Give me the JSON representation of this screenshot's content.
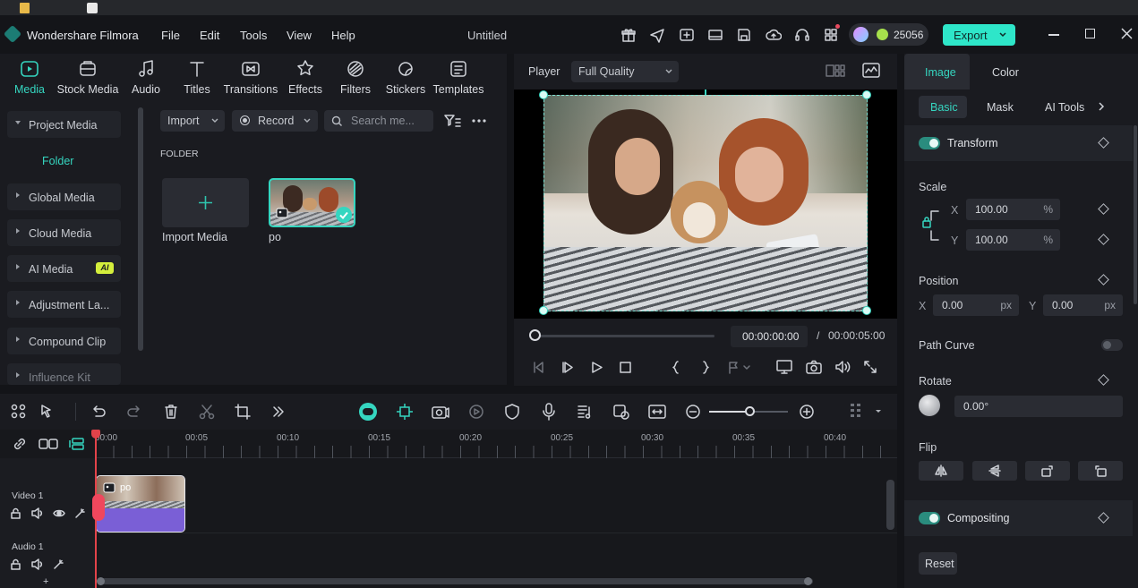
{
  "app": {
    "title": "Wondershare Filmora",
    "project_title": "Untitled",
    "credits": "25056",
    "export_label": "Export"
  },
  "menu": [
    "File",
    "Edit",
    "Tools",
    "View",
    "Help"
  ],
  "media_tabs": [
    "Media",
    "Stock Media",
    "Audio",
    "Titles",
    "Transitions",
    "Effects",
    "Filters",
    "Stickers",
    "Templates"
  ],
  "sidebar": {
    "project_media": "Project Media",
    "folder": "Folder",
    "items": [
      "Global Media",
      "Cloud Media",
      "AI Media",
      "Adjustment La...",
      "Compound Clip",
      "Influence Kit"
    ],
    "ai_badge": "AI"
  },
  "media": {
    "import_label": "Import",
    "record_label": "Record",
    "search_placeholder": "Search me...",
    "folder_heading": "FOLDER",
    "import_media_label": "Import Media",
    "clip_name": "po"
  },
  "player": {
    "label": "Player",
    "quality": "Full Quality",
    "current_time": "00:00:00:00",
    "separator": "/",
    "total_time": "00:00:05:00",
    "progress": 0
  },
  "props": {
    "tabs": [
      "Image",
      "Color"
    ],
    "subtabs": [
      "Basic",
      "Mask",
      "AI Tools"
    ],
    "transform": "Transform",
    "scale": "Scale",
    "scale_x": "100.00",
    "scale_y": "100.00",
    "percent": "%",
    "axis_x": "X",
    "axis_y": "Y",
    "position": "Position",
    "pos_x": "0.00",
    "pos_y": "0.00",
    "px": "px",
    "path_curve": "Path Curve",
    "rotate": "Rotate",
    "rotate_value": "0.00°",
    "flip": "Flip",
    "compositing": "Compositing",
    "reset": "Reset"
  },
  "timeline": {
    "ruler": [
      "00:00",
      "00:05",
      "00:10",
      "00:15",
      "00:20",
      "00:25",
      "00:30",
      "00:35",
      "00:40"
    ],
    "video_track": "Video 1",
    "audio_track": "Audio 1",
    "clip_label": "po",
    "zoom": 0.7
  },
  "colors": {
    "accent": "#35d6c0",
    "export_bg": "#2ee6c9",
    "clip_purple": "#7a5fd6",
    "playhead": "#e2434a"
  }
}
